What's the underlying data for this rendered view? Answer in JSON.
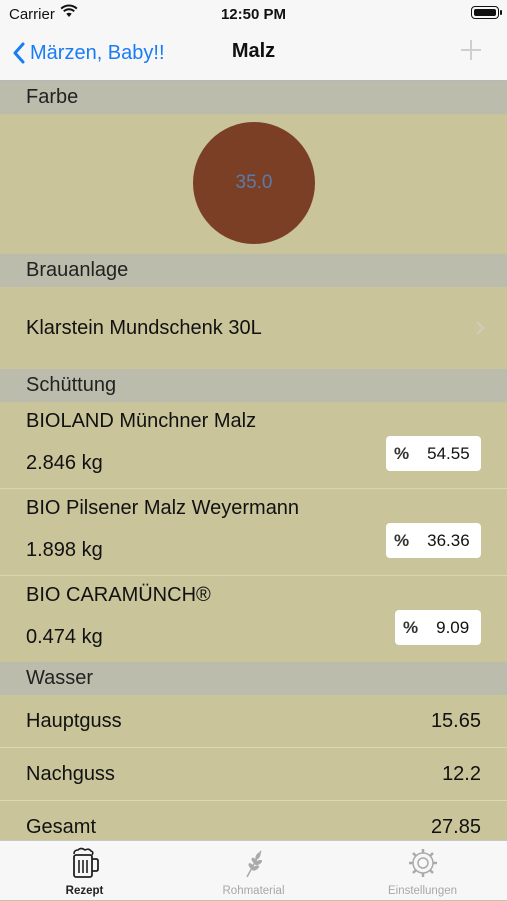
{
  "status": {
    "carrier": "Carrier",
    "time": "12:50 PM"
  },
  "nav": {
    "back_label": "Märzen, Baby!!",
    "title": "Malz",
    "add_icon": "plus-icon"
  },
  "sections": {
    "farbe": {
      "header": "Farbe",
      "value": "35.0",
      "color": "#7a3f24"
    },
    "brauanlage": {
      "header": "Brauanlage",
      "value": "Klarstein Mundschenk 30L"
    },
    "schuettung": {
      "header": "Schüttung",
      "items": [
        {
          "name": "BIOLAND Münchner Malz",
          "amount": "2.846 kg",
          "percent_sign": "%",
          "percent": "54.55"
        },
        {
          "name": "BIO Pilsener Malz  Weyermann",
          "amount": "1.898 kg",
          "percent_sign": "%",
          "percent": "36.36"
        },
        {
          "name": "BIO CARAMÜNCH®",
          "amount": "0.474 kg",
          "percent_sign": "%",
          "percent": "9.09"
        }
      ]
    },
    "wasser": {
      "header": "Wasser",
      "rows": [
        {
          "label": "Hauptguss",
          "value": "15.65"
        },
        {
          "label": "Nachguss",
          "value": "12.2"
        },
        {
          "label": "Gesamt",
          "value": "27.85"
        }
      ]
    }
  },
  "tabs": [
    {
      "label": "Rezept",
      "icon": "beer-mug-icon",
      "active": true
    },
    {
      "label": "Rohmaterial",
      "icon": "wheat-icon",
      "active": false
    },
    {
      "label": "Einstellungen",
      "icon": "gear-icon",
      "active": false
    }
  ],
  "colors": {
    "accent": "#1a7cf5",
    "background": "#c9c49a",
    "section_header": "#bcbcac"
  }
}
